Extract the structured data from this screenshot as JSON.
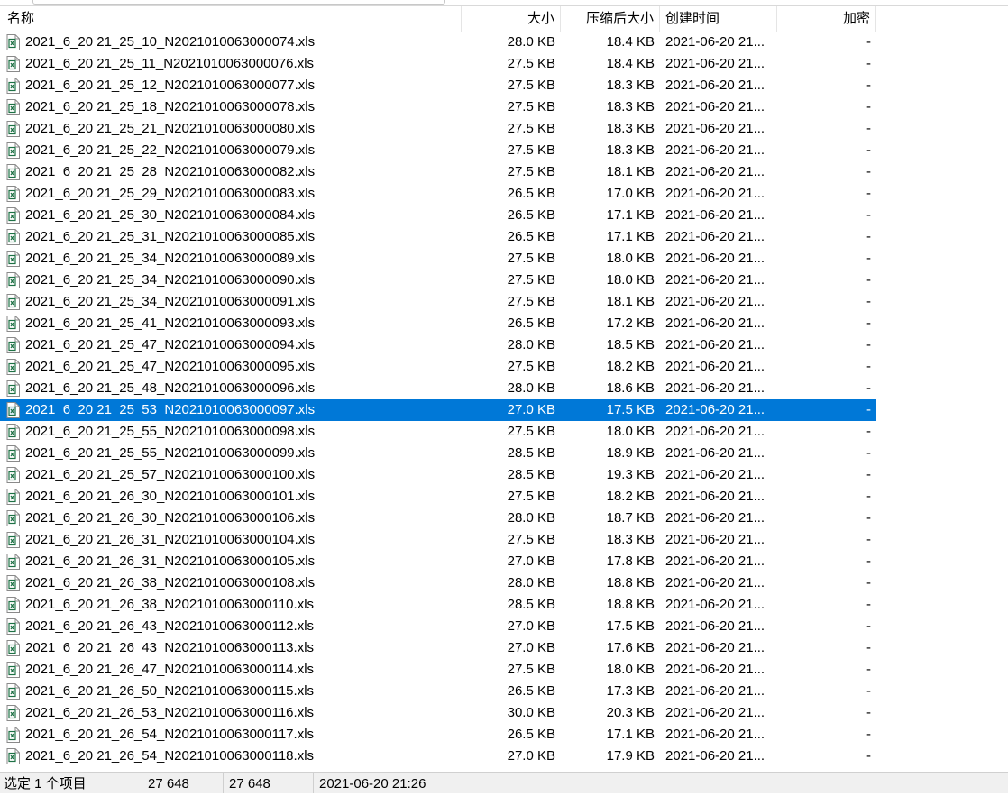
{
  "columns": {
    "name": "名称",
    "size": "大小",
    "compressed": "压缩后大小",
    "created": "创建时间",
    "encrypted": "加密"
  },
  "rows": [
    {
      "name": "2021_6_20 21_25_10_N2021010063000074.xls",
      "size": "28.0 KB",
      "compressed": "18.4 KB",
      "created": "2021-06-20 21...",
      "encrypted": "-"
    },
    {
      "name": "2021_6_20 21_25_11_N2021010063000076.xls",
      "size": "27.5 KB",
      "compressed": "18.4 KB",
      "created": "2021-06-20 21...",
      "encrypted": "-"
    },
    {
      "name": "2021_6_20 21_25_12_N2021010063000077.xls",
      "size": "27.5 KB",
      "compressed": "18.3 KB",
      "created": "2021-06-20 21...",
      "encrypted": "-"
    },
    {
      "name": "2021_6_20 21_25_18_N2021010063000078.xls",
      "size": "27.5 KB",
      "compressed": "18.3 KB",
      "created": "2021-06-20 21...",
      "encrypted": "-"
    },
    {
      "name": "2021_6_20 21_25_21_N2021010063000080.xls",
      "size": "27.5 KB",
      "compressed": "18.3 KB",
      "created": "2021-06-20 21...",
      "encrypted": "-"
    },
    {
      "name": "2021_6_20 21_25_22_N2021010063000079.xls",
      "size": "27.5 KB",
      "compressed": "18.3 KB",
      "created": "2021-06-20 21...",
      "encrypted": "-"
    },
    {
      "name": "2021_6_20 21_25_28_N2021010063000082.xls",
      "size": "27.5 KB",
      "compressed": "18.1 KB",
      "created": "2021-06-20 21...",
      "encrypted": "-"
    },
    {
      "name": "2021_6_20 21_25_29_N2021010063000083.xls",
      "size": "26.5 KB",
      "compressed": "17.0 KB",
      "created": "2021-06-20 21...",
      "encrypted": "-"
    },
    {
      "name": "2021_6_20 21_25_30_N2021010063000084.xls",
      "size": "26.5 KB",
      "compressed": "17.1 KB",
      "created": "2021-06-20 21...",
      "encrypted": "-"
    },
    {
      "name": "2021_6_20 21_25_31_N2021010063000085.xls",
      "size": "26.5 KB",
      "compressed": "17.1 KB",
      "created": "2021-06-20 21...",
      "encrypted": "-"
    },
    {
      "name": "2021_6_20 21_25_34_N2021010063000089.xls",
      "size": "27.5 KB",
      "compressed": "18.0 KB",
      "created": "2021-06-20 21...",
      "encrypted": "-"
    },
    {
      "name": "2021_6_20 21_25_34_N2021010063000090.xls",
      "size": "27.5 KB",
      "compressed": "18.0 KB",
      "created": "2021-06-20 21...",
      "encrypted": "-"
    },
    {
      "name": "2021_6_20 21_25_34_N2021010063000091.xls",
      "size": "27.5 KB",
      "compressed": "18.1 KB",
      "created": "2021-06-20 21...",
      "encrypted": "-"
    },
    {
      "name": "2021_6_20 21_25_41_N2021010063000093.xls",
      "size": "26.5 KB",
      "compressed": "17.2 KB",
      "created": "2021-06-20 21...",
      "encrypted": "-"
    },
    {
      "name": "2021_6_20 21_25_47_N2021010063000094.xls",
      "size": "28.0 KB",
      "compressed": "18.5 KB",
      "created": "2021-06-20 21...",
      "encrypted": "-"
    },
    {
      "name": "2021_6_20 21_25_47_N2021010063000095.xls",
      "size": "27.5 KB",
      "compressed": "18.2 KB",
      "created": "2021-06-20 21...",
      "encrypted": "-"
    },
    {
      "name": "2021_6_20 21_25_48_N2021010063000096.xls",
      "size": "28.0 KB",
      "compressed": "18.6 KB",
      "created": "2021-06-20 21...",
      "encrypted": "-"
    },
    {
      "name": "2021_6_20 21_25_53_N2021010063000097.xls",
      "size": "27.0 KB",
      "compressed": "17.5 KB",
      "created": "2021-06-20 21...",
      "encrypted": "-",
      "selected": true
    },
    {
      "name": "2021_6_20 21_25_55_N2021010063000098.xls",
      "size": "27.5 KB",
      "compressed": "18.0 KB",
      "created": "2021-06-20 21...",
      "encrypted": "-"
    },
    {
      "name": "2021_6_20 21_25_55_N2021010063000099.xls",
      "size": "28.5 KB",
      "compressed": "18.9 KB",
      "created": "2021-06-20 21...",
      "encrypted": "-"
    },
    {
      "name": "2021_6_20 21_25_57_N2021010063000100.xls",
      "size": "28.5 KB",
      "compressed": "19.3 KB",
      "created": "2021-06-20 21...",
      "encrypted": "-"
    },
    {
      "name": "2021_6_20 21_26_30_N2021010063000101.xls",
      "size": "27.5 KB",
      "compressed": "18.2 KB",
      "created": "2021-06-20 21...",
      "encrypted": "-"
    },
    {
      "name": "2021_6_20 21_26_30_N2021010063000106.xls",
      "size": "28.0 KB",
      "compressed": "18.7 KB",
      "created": "2021-06-20 21...",
      "encrypted": "-"
    },
    {
      "name": "2021_6_20 21_26_31_N2021010063000104.xls",
      "size": "27.5 KB",
      "compressed": "18.3 KB",
      "created": "2021-06-20 21...",
      "encrypted": "-"
    },
    {
      "name": "2021_6_20 21_26_31_N2021010063000105.xls",
      "size": "27.0 KB",
      "compressed": "17.8 KB",
      "created": "2021-06-20 21...",
      "encrypted": "-"
    },
    {
      "name": "2021_6_20 21_26_38_N2021010063000108.xls",
      "size": "28.0 KB",
      "compressed": "18.8 KB",
      "created": "2021-06-20 21...",
      "encrypted": "-"
    },
    {
      "name": "2021_6_20 21_26_38_N2021010063000110.xls",
      "size": "28.5 KB",
      "compressed": "18.8 KB",
      "created": "2021-06-20 21...",
      "encrypted": "-"
    },
    {
      "name": "2021_6_20 21_26_43_N2021010063000112.xls",
      "size": "27.0 KB",
      "compressed": "17.5 KB",
      "created": "2021-06-20 21...",
      "encrypted": "-"
    },
    {
      "name": "2021_6_20 21_26_43_N2021010063000113.xls",
      "size": "27.0 KB",
      "compressed": "17.6 KB",
      "created": "2021-06-20 21...",
      "encrypted": "-"
    },
    {
      "name": "2021_6_20 21_26_47_N2021010063000114.xls",
      "size": "27.5 KB",
      "compressed": "18.0 KB",
      "created": "2021-06-20 21...",
      "encrypted": "-"
    },
    {
      "name": "2021_6_20 21_26_50_N2021010063000115.xls",
      "size": "26.5 KB",
      "compressed": "17.3 KB",
      "created": "2021-06-20 21...",
      "encrypted": "-"
    },
    {
      "name": "2021_6_20 21_26_53_N2021010063000116.xls",
      "size": "30.0 KB",
      "compressed": "20.3 KB",
      "created": "2021-06-20 21...",
      "encrypted": "-"
    },
    {
      "name": "2021_6_20 21_26_54_N2021010063000117.xls",
      "size": "26.5 KB",
      "compressed": "17.1 KB",
      "created": "2021-06-20 21...",
      "encrypted": "-"
    },
    {
      "name": "2021_6_20 21_26_54_N2021010063000118.xls",
      "size": "27.0 KB",
      "compressed": "17.9 KB",
      "created": "2021-06-20 21...",
      "encrypted": "-"
    }
  ],
  "status": {
    "selection": "选定 1 个项目",
    "size": "27 648",
    "compressed": "27 648",
    "datetime": "2021-06-20 21:26"
  },
  "colors": {
    "selection": "#0078d7",
    "excel_icon": "#1e7145"
  },
  "icons": {
    "file": "excel-file-icon"
  }
}
